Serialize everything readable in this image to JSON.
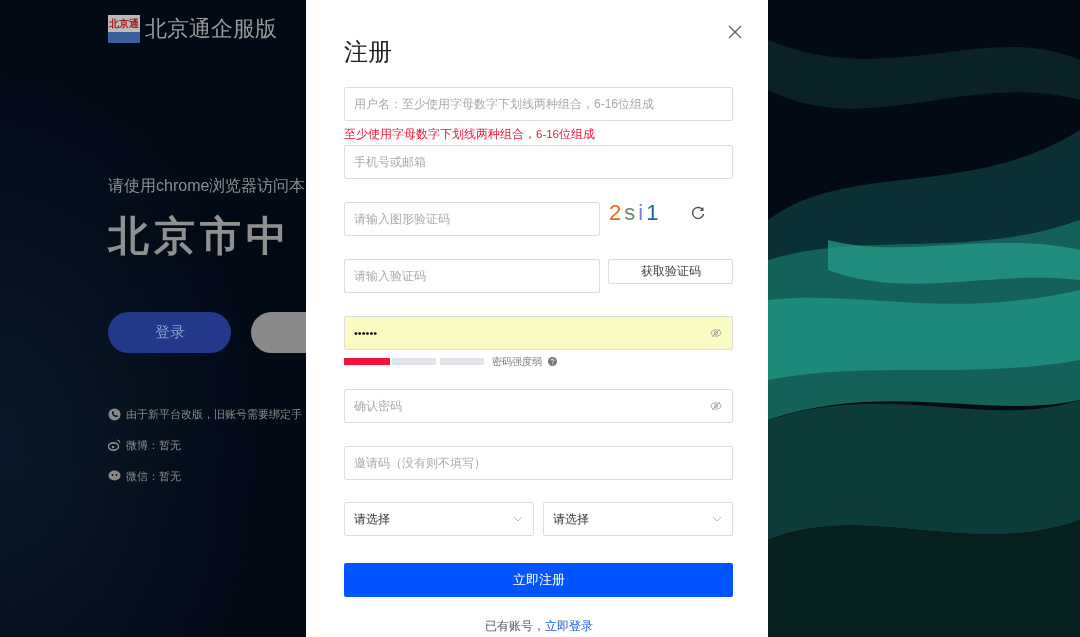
{
  "brand": {
    "logo_text": "北京通",
    "name": "北京通企服版"
  },
  "hero": {
    "notice": "请使用chrome浏览器访问本",
    "headline": "北京市中",
    "login_button": "登录"
  },
  "contacts": [
    {
      "kind": "phone",
      "text": "由于新平台改版，旧账号需要绑定手"
    },
    {
      "kind": "weibo",
      "text": "微博：暂无"
    },
    {
      "kind": "wechat",
      "text": "微信：暂无"
    }
  ],
  "dialog": {
    "title": "注册",
    "fields": [
      {
        "kind": "text",
        "placeholder": "用户名：至少使用字母数字下划线两种组合，6-16位组成",
        "error": "至少使用字母数字下划线两种组合，6-16位组成"
      },
      {
        "kind": "text",
        "placeholder": "手机号或邮箱"
      },
      {
        "kind": "captcha",
        "placeholder": "请输入图形验证码",
        "code": "2si1"
      },
      {
        "kind": "sms",
        "placeholder": "请输入验证码",
        "button": "获取验证码"
      },
      {
        "kind": "password",
        "value": "••••••",
        "autofilled": true,
        "strength": {
          "level": 0.34,
          "label": "密码强度弱"
        }
      },
      {
        "kind": "password",
        "placeholder": "确认密码",
        "autofilled": false
      },
      {
        "kind": "text",
        "placeholder": "邀请码（没有则不填写）"
      },
      {
        "kind": "selects",
        "options": [
          {
            "placeholder": "请选择"
          },
          {
            "placeholder": "请选择"
          }
        ]
      }
    ],
    "submit": "立即注册",
    "footer": {
      "text": "已有账号，",
      "link": "立即登录"
    }
  }
}
